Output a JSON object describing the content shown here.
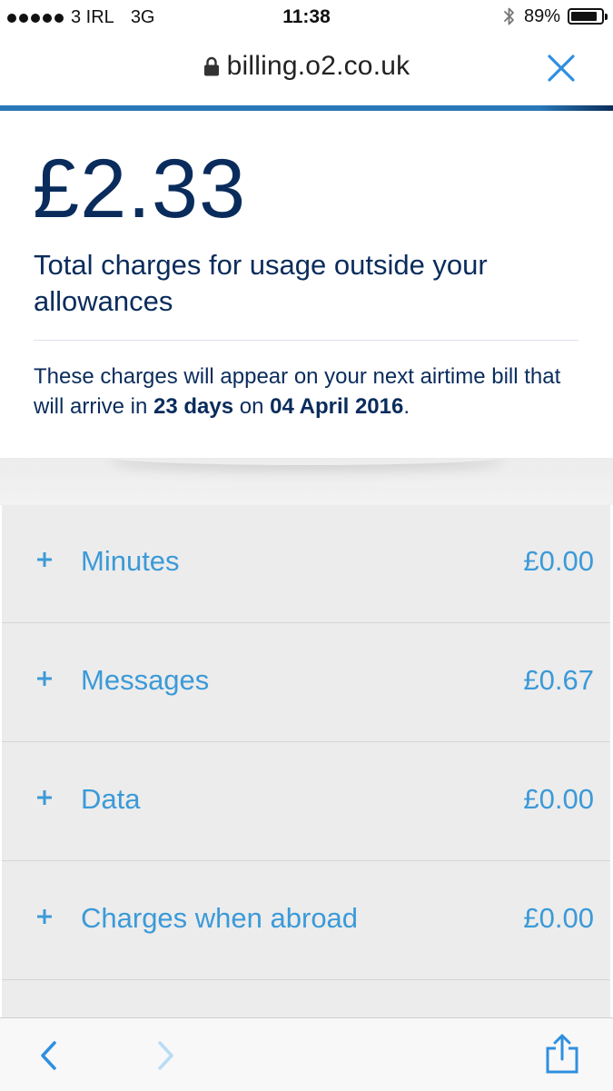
{
  "status_bar": {
    "carrier": "3 IRL",
    "network": "3G",
    "time": "11:38",
    "battery": "89%",
    "battery_level": 0.89
  },
  "browser": {
    "url": "billing.o2.co.uk"
  },
  "summary": {
    "amount": "£2.33",
    "caption": "Total charges for usage outside your allowances",
    "notice_pre": "These charges will appear on your next airtime bill that will arrive in ",
    "notice_days": "23 days",
    "notice_mid": " on ",
    "notice_date": "04 April 2016",
    "notice_post": "."
  },
  "charges": [
    {
      "label": "Minutes",
      "amount": "£0.00"
    },
    {
      "label": "Messages",
      "amount": "£0.67"
    },
    {
      "label": "Data",
      "amount": "£0.00"
    },
    {
      "label": "Charges when abroad",
      "amount": "£0.00"
    }
  ],
  "colors": {
    "navy": "#0a2c5c",
    "link_blue": "#3b9ad8",
    "ios_blue": "#2f8fe0",
    "list_bg": "#ececec"
  },
  "icons": {
    "close": "close-icon",
    "lock": "lock-icon",
    "expand": "plus-icon",
    "back": "chevron-left-icon",
    "forward": "chevron-right-icon",
    "share": "share-icon"
  }
}
